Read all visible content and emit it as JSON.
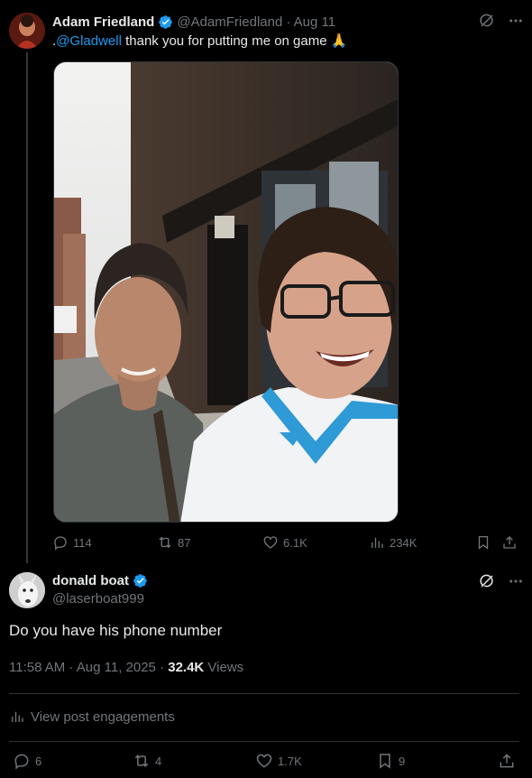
{
  "parent_tweet": {
    "author_name": "Adam Friedland",
    "handle": "@AdamFriedland",
    "date": "· Aug 11",
    "text_prefix": ".",
    "mention": "@Gladwell",
    "text_body": " thank you for putting me on game 🙏",
    "counts": {
      "replies": "114",
      "reposts": "87",
      "likes": "6.1K",
      "views": "234K"
    }
  },
  "focal_tweet": {
    "author_name": "donald boat",
    "handle": "@laserboat999",
    "text": "Do you have his phone number",
    "time": "11:58 AM · Aug 11, 2025 · ",
    "views_count": "32.4K",
    "views_label": " Views",
    "engagements_label": "View post engagements",
    "counts": {
      "replies": "6",
      "reposts": "4",
      "likes": "1.7K",
      "bookmarks": "9"
    }
  },
  "colors": {
    "background": "#000000",
    "text": "#e7e9ea",
    "muted": "#71767b",
    "accent": "#1d9bf0",
    "divider": "#2f3336"
  },
  "icons": [
    "verified-badge-icon",
    "grok-icon",
    "more-icon",
    "reply-icon",
    "repost-icon",
    "like-icon",
    "views-icon",
    "bookmark-icon",
    "share-icon"
  ]
}
